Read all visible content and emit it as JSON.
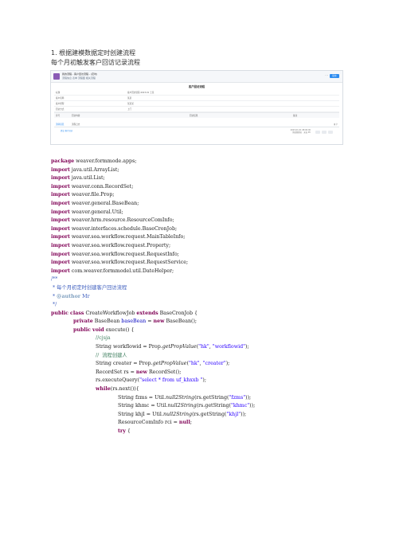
{
  "doc": {
    "heading": "1.  根据建模数据定时创建流程",
    "subheading": "每个月初触发客户回访记录流程"
  },
  "screenshot": {
    "breadcrumb": "我的流程 - 客户回访流程 - (定时)",
    "breadcrumb_sub": "流程信息  表单  流程图  相关流程",
    "save_label": "提交",
    "form_title": "客户回访流程",
    "fields": [
      {
        "label": "标题",
        "value": "客户回访流程-2023-01    王某"
      },
      {
        "label": "客户名称",
        "value": "某某"
      },
      {
        "label": "客户经理",
        "value": "张某某"
      },
      {
        "label": "回访方式",
        "value": "上门"
      }
    ],
    "detail_headers": [
      "序号",
      "回访内容",
      "回访结果",
      "备注"
    ],
    "tabs": [
      "流转意见",
      "流程日志"
    ],
    "sign_text": "提交 客户回访",
    "sign_sub": "",
    "meta_line1": "2023-01-01 08:00:00",
    "meta_line2": "系统管理员 · 来自 PC"
  },
  "code": {
    "l01": [
      "package",
      " weaver.formmode.apps;"
    ],
    "l02": [
      "import",
      " java.util.ArrayList;"
    ],
    "l03": [
      "import",
      " java.util.List;"
    ],
    "l04": [
      "import",
      " weaver.conn.RecordSet;"
    ],
    "l05": [
      "import",
      " weaver.file.Prop;"
    ],
    "l06": [
      "import",
      " weaver.general.BaseBean;"
    ],
    "l07": [
      "import",
      " weaver.general.Util;"
    ],
    "l08": [
      "import",
      " weaver.hrm.resource.ResourceComInfo;"
    ],
    "l09": [
      "import",
      " weaver.interfaces.schedule.BaseCronJob;"
    ],
    "l10": [
      "import",
      " weaver.soa.workflow.request.MainTableInfo;"
    ],
    "l11": [
      "import",
      " weaver.soa.workflow.request.Property;"
    ],
    "l12": [
      "import",
      " weaver.soa.workflow.request.RequestInfo;"
    ],
    "l13": [
      "import",
      " weaver.soa.workflow.request.RequestService;"
    ],
    "l14": [
      "import",
      " com.weaver.formmodel.util.DateHelper;"
    ],
    "l15": "/**",
    "l16": " * 每个月初定时创建客户回访流程",
    "l17a": " * ",
    "l17b": "@author",
    "l17c": " Mr",
    "l18": " */",
    "l19": [
      "public",
      " ",
      "class",
      " CreateWorkflowJob ",
      "extends",
      " BaseCronJob {"
    ],
    "l20": [
      "private",
      " BaseBean ",
      "baseBean",
      " = ",
      "new",
      " BaseBean();"
    ],
    "l21": [
      "public",
      " ",
      "void",
      " execute() {"
    ],
    "l22": "//cjsja",
    "l23a": "String workflowid = Prop.",
    "l23b": "getPropValue",
    "l23c": "(\"hk\", \"workflowid\");",
    "l23s1": "\"hk\"",
    "l23s2": "\"workflowid\"",
    "l24": "//  流程创建人",
    "l25a": "String creater = Prop.",
    "l25b": "getPropValue",
    "l25s1": "\"hk\"",
    "l25s2": "\"creater\"",
    "l26a": "RecordSet rs = ",
    "l26b": "new",
    "l26c": " RecordSet();",
    "l27a": "rs.executeQuery(",
    "l27s": "\"select * from uf_khxxb \"",
    "l27c": ");",
    "l28a": "while",
    "l28b": "(rs.next()){",
    "l29a": "String fzms = Util.",
    "l29b": "null2String",
    "l29c": "(rs.getString(",
    "l29s": "\"fzms\"",
    "l29d": "));",
    "l30a": "String khmc = Util.",
    "l30s": "\"khmc\"",
    "l31a": "String khjl = Util.",
    "l31s": "\"khjl\"",
    "l32a": "ResourceComInfo rci = ",
    "l32b": "null",
    "l32c": ";",
    "l33a": "try",
    "l33b": " {"
  }
}
